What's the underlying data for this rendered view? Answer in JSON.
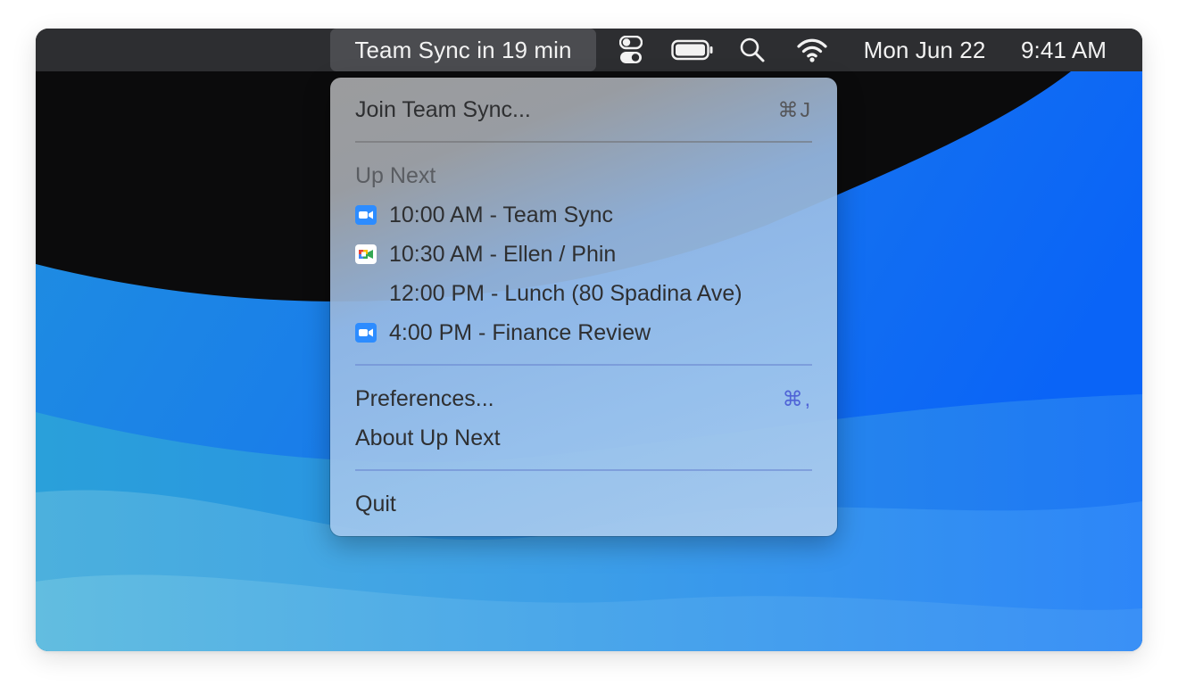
{
  "menubar": {
    "status_title": "Team Sync in 19 min",
    "control_center_icon": "control-center-icon",
    "battery_icon": "battery-icon",
    "search_icon": "spotlight-search-icon",
    "wifi_icon": "wifi-icon",
    "date": "Mon Jun 22",
    "time": "9:41 AM"
  },
  "menu": {
    "join": {
      "label": "Join Team Sync...",
      "shortcut": "⌘J"
    },
    "section_header": "Up Next",
    "events": [
      {
        "label": "10:00 AM - Team Sync",
        "icon": "zoom-icon"
      },
      {
        "label": "10:30 AM - Ellen / Phin",
        "icon": "google-meet-icon"
      },
      {
        "label": "12:00 PM - Lunch (80 Spadina Ave)",
        "icon": ""
      },
      {
        "label": "4:00 PM - Finance Review",
        "icon": "zoom-icon"
      }
    ],
    "preferences": {
      "label": "Preferences...",
      "shortcut": "⌘,"
    },
    "about": {
      "label": "About Up Next"
    },
    "quit": {
      "label": "Quit"
    }
  },
  "colors": {
    "menubar_bg": "#2d2e31",
    "status_highlight": "#4b4c50",
    "zoom_blue": "#2d8cff",
    "shortcut_accent": "#4f63d6",
    "wallpaper_dark": "#0b0b0c",
    "wallpaper_blue": "#1a7cf0"
  }
}
